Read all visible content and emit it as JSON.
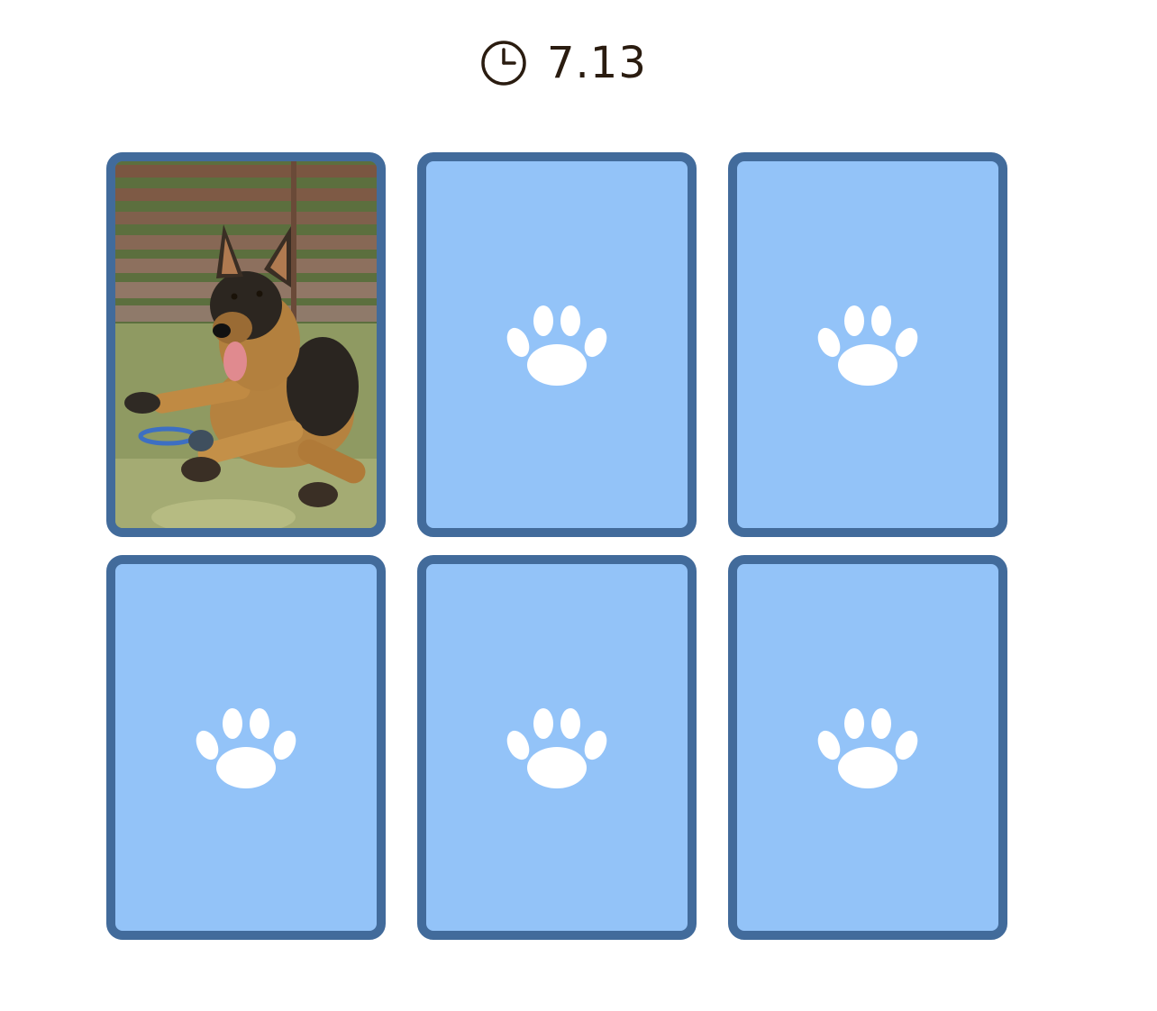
{
  "timer": {
    "icon": "clock-icon",
    "value": "7.13"
  },
  "colors": {
    "card_border": "#426b9b",
    "card_back": "#93c3f8",
    "paw": "#ffffff",
    "timer_text": "#2a1c10"
  },
  "cards": [
    {
      "state": "face-up",
      "content": "german-shepherd-photo"
    },
    {
      "state": "face-down",
      "icon": "paw-icon"
    },
    {
      "state": "face-down",
      "icon": "paw-icon"
    },
    {
      "state": "face-down",
      "icon": "paw-icon"
    },
    {
      "state": "face-down",
      "icon": "paw-icon"
    },
    {
      "state": "face-down",
      "icon": "paw-icon"
    }
  ]
}
